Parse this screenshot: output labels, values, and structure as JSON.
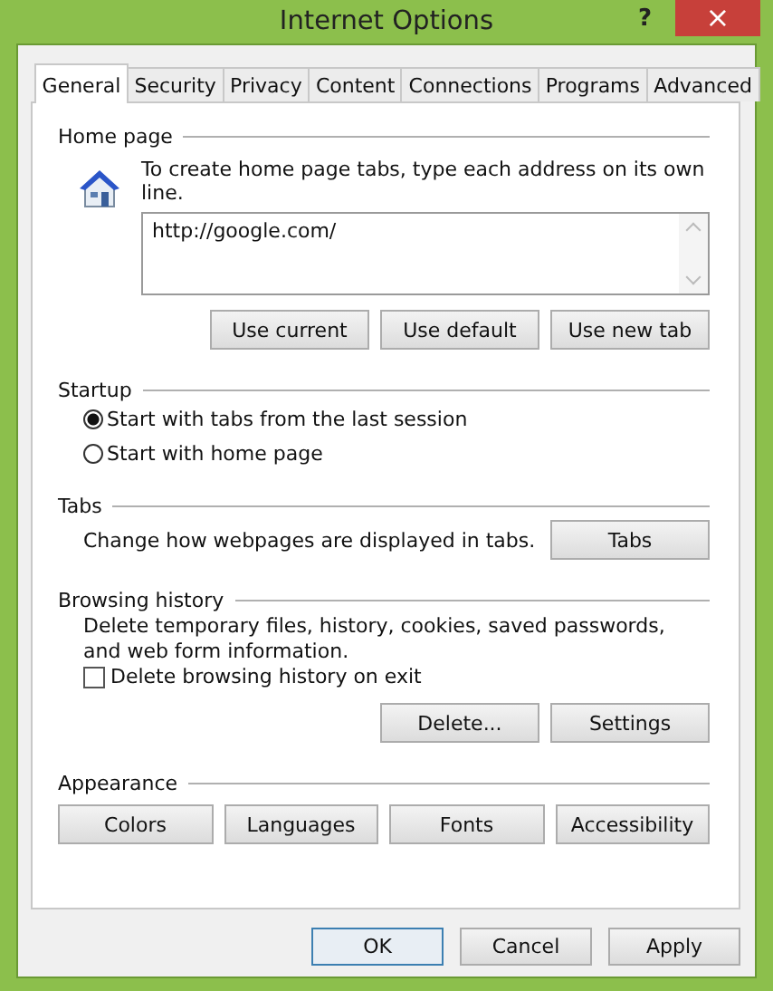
{
  "window": {
    "title": "Internet Options",
    "help": "?",
    "close": "×"
  },
  "tabs": [
    {
      "label": "General",
      "selected": true
    },
    {
      "label": "Security",
      "selected": false
    },
    {
      "label": "Privacy",
      "selected": false
    },
    {
      "label": "Content",
      "selected": false
    },
    {
      "label": "Connections",
      "selected": false
    },
    {
      "label": "Programs",
      "selected": false
    },
    {
      "label": "Advanced",
      "selected": false
    }
  ],
  "home_page": {
    "heading": "Home page",
    "hint": "To create home page tabs, type each address on its own line.",
    "value": "http://google.com/",
    "buttons": [
      "Use current",
      "Use default",
      "Use new tab"
    ]
  },
  "startup": {
    "heading": "Startup",
    "options": [
      {
        "label": "Start with tabs from the last session",
        "selected": true
      },
      {
        "label": "Start with home page",
        "selected": false
      }
    ]
  },
  "tabs_section": {
    "heading": "Tabs",
    "text": "Change how webpages are displayed in tabs.",
    "button": "Tabs"
  },
  "browsing_history": {
    "heading": "Browsing history",
    "text": "Delete temporary files, history, cookies, saved passwords, and web form information.",
    "checkbox": {
      "label": "Delete browsing history on exit",
      "checked": false
    },
    "buttons": [
      "Delete...",
      "Settings"
    ]
  },
  "appearance": {
    "heading": "Appearance",
    "buttons": [
      "Colors",
      "Languages",
      "Fonts",
      "Accessibility"
    ]
  },
  "footer_buttons": [
    {
      "label": "OK",
      "default": true
    },
    {
      "label": "Cancel",
      "default": false
    },
    {
      "label": "Apply",
      "default": false
    }
  ]
}
